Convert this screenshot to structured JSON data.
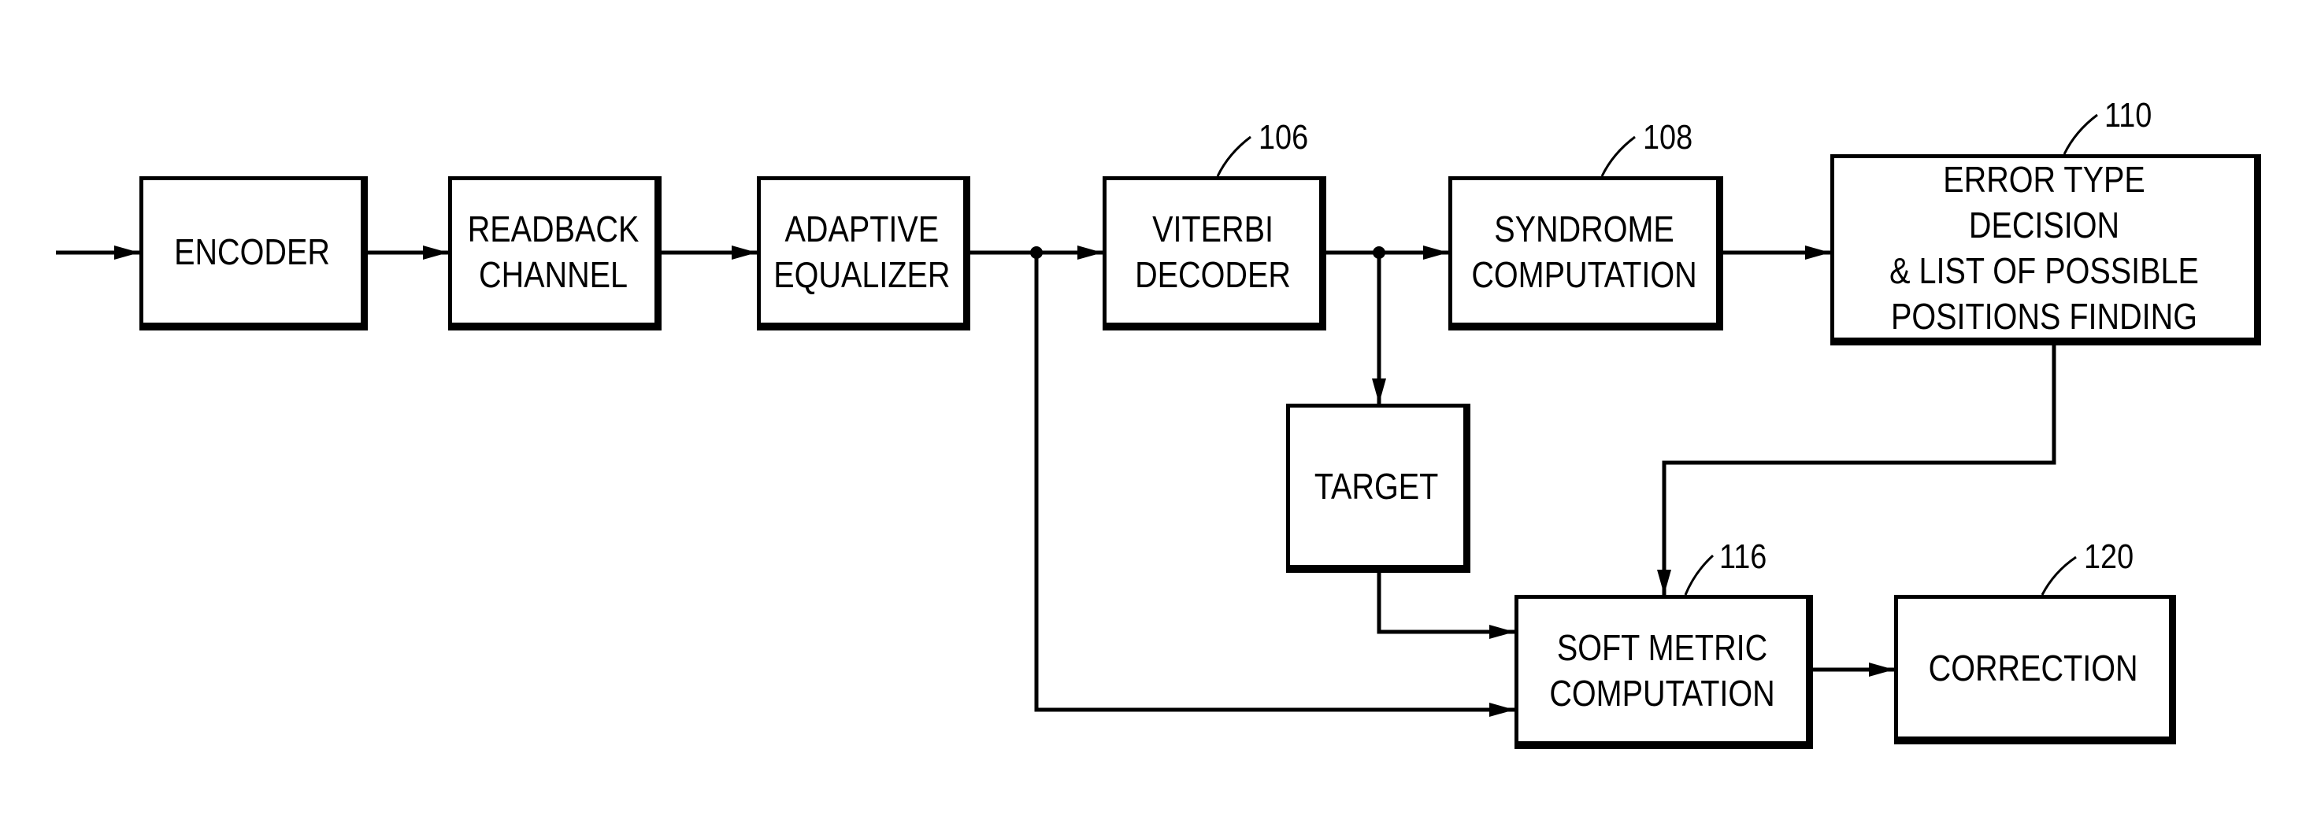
{
  "diagram": {
    "type": "block-diagram",
    "blocks": {
      "encoder": {
        "label": "ENCODER"
      },
      "readback_channel": {
        "label": "READBACK\nCHANNEL"
      },
      "adaptive_equalizer": {
        "label": "ADAPTIVE\nEQUALIZER"
      },
      "viterbi_decoder": {
        "label": "VITERBI\nDECODER",
        "ref": "106"
      },
      "syndrome_computation": {
        "label": "SYNDROME\nCOMPUTATION",
        "ref": "108"
      },
      "error_type_decision": {
        "label": "ERROR TYPE DECISION\n& LIST OF POSSIBLE\nPOSITIONS FINDING",
        "ref": "110"
      },
      "target": {
        "label": "TARGET"
      },
      "soft_metric_computation": {
        "label": "SOFT METRIC\nCOMPUTATION",
        "ref": "116"
      },
      "correction": {
        "label": "CORRECTION",
        "ref": "120"
      }
    },
    "connections": [
      {
        "from": "input",
        "to": "encoder"
      },
      {
        "from": "encoder",
        "to": "readback_channel"
      },
      {
        "from": "readback_channel",
        "to": "adaptive_equalizer"
      },
      {
        "from": "adaptive_equalizer",
        "to": "viterbi_decoder"
      },
      {
        "from": "adaptive_equalizer",
        "to": "soft_metric_computation"
      },
      {
        "from": "viterbi_decoder",
        "to": "syndrome_computation"
      },
      {
        "from": "viterbi_decoder",
        "to": "target"
      },
      {
        "from": "syndrome_computation",
        "to": "error_type_decision"
      },
      {
        "from": "error_type_decision",
        "to": "soft_metric_computation"
      },
      {
        "from": "target",
        "to": "soft_metric_computation"
      },
      {
        "from": "soft_metric_computation",
        "to": "correction"
      }
    ]
  }
}
